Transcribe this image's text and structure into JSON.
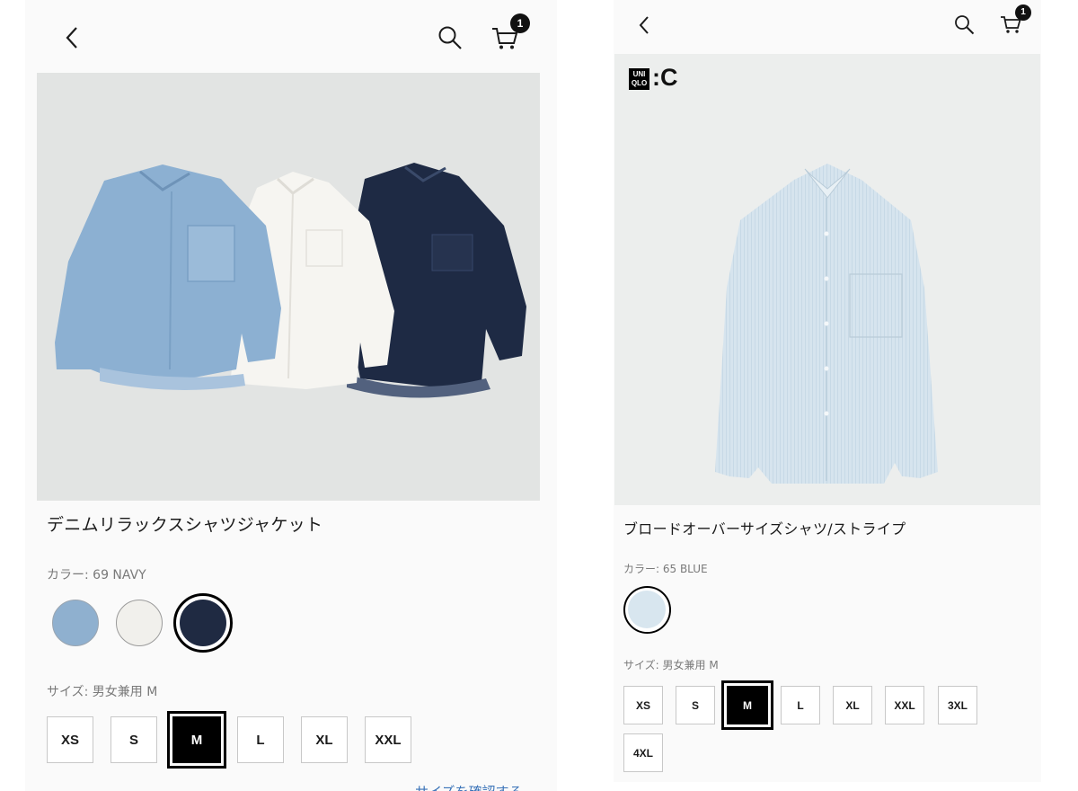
{
  "left": {
    "header": {
      "back_icon": "chevron-left-icon",
      "search_icon": "search-icon",
      "cart_icon": "cart-icon",
      "cart_count": "1"
    },
    "product": {
      "title": "デニムリラックスシャツジャケット",
      "color_label": "カラー: 69 NAVY",
      "colors": [
        {
          "name": "light denim",
          "hex": "#8fb0cf",
          "selected": false
        },
        {
          "name": "off white",
          "hex": "#f1f0ec",
          "selected": false
        },
        {
          "name": "navy",
          "hex": "#1f2a42",
          "selected": true
        }
      ],
      "size_label": "サイズ: 男女兼用 M",
      "sizes": [
        "XS",
        "S",
        "M",
        "L",
        "XL",
        "XXL"
      ],
      "selected_size": "M",
      "size_check_link": "サイズを確認する"
    }
  },
  "right": {
    "header": {
      "back_icon": "chevron-left-icon",
      "search_icon": "search-icon",
      "cart_icon": "cart-icon",
      "cart_count": "1"
    },
    "brand_logo": {
      "box_text": "UNI QLO",
      "suffix": ":C"
    },
    "product": {
      "title": "ブロードオーバーサイズシャツ/ストライプ",
      "color_label": "カラー: 65 BLUE",
      "colors": [
        {
          "name": "blue",
          "hex": "#d8e6ef",
          "selected": true
        }
      ],
      "size_label": "サイズ: 男女兼用 M",
      "sizes": [
        "XS",
        "S",
        "M",
        "L",
        "XL",
        "XXL",
        "3XL",
        "4XL"
      ],
      "selected_size": "M"
    }
  }
}
